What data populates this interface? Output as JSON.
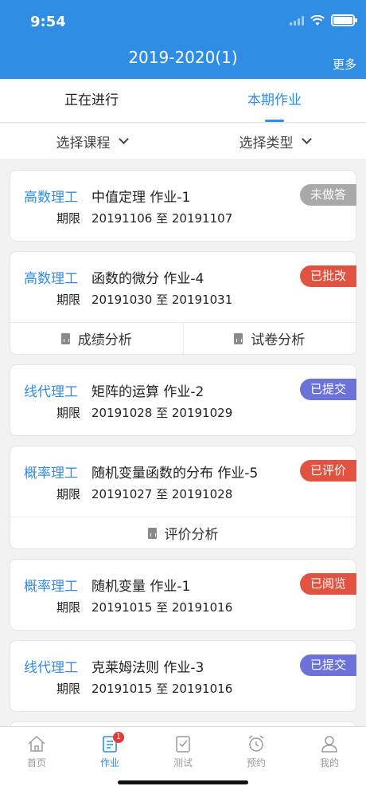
{
  "status_bar": {
    "time": "9:54"
  },
  "nav": {
    "title": "2019-2020(1)",
    "more": "更多"
  },
  "tabs": [
    {
      "label": "正在进行",
      "active": false
    },
    {
      "label": "本期作业",
      "active": true
    }
  ],
  "filters": {
    "course": "选择课程",
    "type": "选择类型"
  },
  "assignments": [
    {
      "course": "高数理工",
      "title": "中值定理 作业-1",
      "period_label": "期限",
      "period": "20191106 至 20191107",
      "status": "未做答",
      "status_color": "#a9a9a9"
    },
    {
      "course": "高数理工",
      "title": "函数的微分 作业-4",
      "period_label": "期限",
      "period": "20191030 至 20191031",
      "status": "已批改",
      "status_color": "#e25241",
      "actions": [
        "成绩分析",
        "试卷分析"
      ]
    },
    {
      "course": "线代理工",
      "title": "矩阵的运算 作业-2",
      "period_label": "期限",
      "period": "20191028 至 20191029",
      "status": "已提交",
      "status_color": "#6c72d8"
    },
    {
      "course": "概率理工",
      "title": "随机变量函数的分布 作业-5",
      "period_label": "期限",
      "period": "20191027 至 20191028",
      "status": "已评价",
      "status_color": "#e25241",
      "actions": [
        "评价分析"
      ]
    },
    {
      "course": "概率理工",
      "title": "随机变量 作业-1",
      "period_label": "期限",
      "period": "20191015 至 20191016",
      "status": "已阅览",
      "status_color": "#e25241"
    },
    {
      "course": "线代理工",
      "title": "克莱姆法则 作业-3",
      "period_label": "期限",
      "period": "20191015 至 20191016",
      "status": "已提交",
      "status_color": "#6c72d8"
    }
  ],
  "tabbar": {
    "items": [
      {
        "label": "首页",
        "icon": "home-icon"
      },
      {
        "label": "作业",
        "icon": "homework-icon",
        "badge": "1",
        "active": true
      },
      {
        "label": "测试",
        "icon": "test-icon"
      },
      {
        "label": "预约",
        "icon": "alarm-clock-icon"
      },
      {
        "label": "我的",
        "icon": "profile-icon"
      }
    ]
  },
  "colors": {
    "primary": "#2f8de4",
    "inactive": "#9a9a9a"
  }
}
